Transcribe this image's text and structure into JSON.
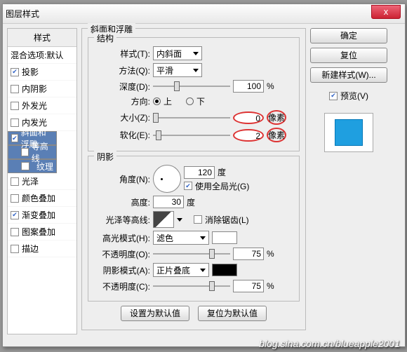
{
  "title": "图层样式",
  "close": "x",
  "sidebar": {
    "header": "样式",
    "items": [
      {
        "label": "混合选项:默认",
        "ck": false,
        "nockbox": true
      },
      {
        "label": "投影",
        "ck": true
      },
      {
        "label": "内阴影",
        "ck": false
      },
      {
        "label": "外发光",
        "ck": false
      },
      {
        "label": "内发光",
        "ck": false
      },
      {
        "label": "斜面和浮雕",
        "ck": true,
        "sel": true
      },
      {
        "label": "等高线",
        "ck": false,
        "sub": true,
        "sel": true
      },
      {
        "label": "纹理",
        "ck": false,
        "sub": true,
        "sel": true
      },
      {
        "label": "光泽",
        "ck": false
      },
      {
        "label": "颜色叠加",
        "ck": false
      },
      {
        "label": "渐变叠加",
        "ck": true
      },
      {
        "label": "图案叠加",
        "ck": false
      },
      {
        "label": "描边",
        "ck": false
      }
    ]
  },
  "panel": {
    "title": "斜面和浮雕",
    "struct": {
      "legend": "结构",
      "style_l": "样式(T):",
      "style_v": "内斜面",
      "tech_l": "方法(Q):",
      "tech_v": "平滑",
      "depth_l": "深度(D):",
      "depth_v": "100",
      "depth_u": "%",
      "dir_l": "方向:",
      "up": "上",
      "down": "下",
      "size_l": "大小(Z):",
      "size_v": "0",
      "size_u": "像素",
      "soft_l": "软化(E):",
      "soft_v": "2",
      "soft_u": "像素"
    },
    "shade": {
      "legend": "阴影",
      "ang_l": "角度(N):",
      "ang_v": "120",
      "ang_u": "度",
      "glob_l": "使用全局光(G)",
      "alt_l": "高度:",
      "alt_v": "30",
      "alt_u": "度",
      "cont_l": "光泽等高线:",
      "aa_l": "消除锯齿(L)",
      "hi_l": "高光模式(H):",
      "hi_v": "滤色",
      "hiop_l": "不透明度(O):",
      "hiop_v": "75",
      "hiop_u": "%",
      "sh_l": "阴影模式(A):",
      "sh_v": "正片叠底",
      "shop_l": "不透明度(C):",
      "shop_v": "75",
      "shop_u": "%"
    },
    "def1": "设置为默认值",
    "def2": "复位为默认值"
  },
  "buttons": {
    "ok": "确定",
    "cancel": "复位",
    "new": "新建样式(W)...",
    "pv": "预览(V)"
  },
  "wm": "blog.sina.com.cn/blueapple2001"
}
